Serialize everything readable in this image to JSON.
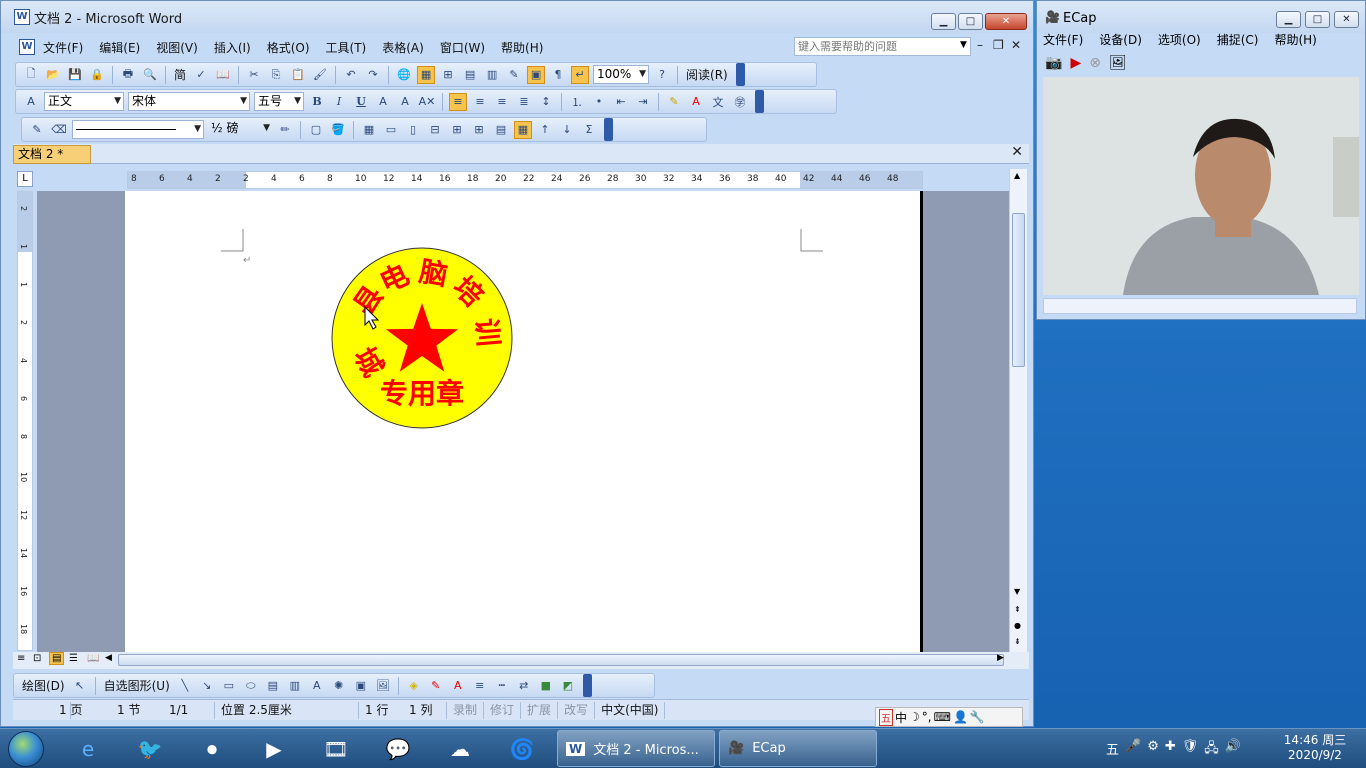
{
  "word": {
    "title": "文档 2 - Microsoft Word",
    "menus": [
      "文件(F)",
      "编辑(E)",
      "视图(V)",
      "插入(I)",
      "格式(O)",
      "工具(T)",
      "表格(A)",
      "窗口(W)",
      "帮助(H)"
    ],
    "help_placeholder": "键入需要帮助的问题",
    "toolbar1": {
      "zoom": "100%",
      "read_label": "阅读(R)",
      "simplified": "简"
    },
    "toolbar2": {
      "style": "正文",
      "font": "宋体",
      "size": "五号"
    },
    "toolbar3": {
      "line_weight": "½ 磅"
    },
    "doc_tab": "文档 2 *",
    "ruler_h": [
      "8",
      "6",
      "4",
      "2",
      "2",
      "4",
      "6",
      "8",
      "10",
      "12",
      "14",
      "16",
      "18",
      "20",
      "22",
      "24",
      "26",
      "28",
      "30",
      "32",
      "34",
      "36",
      "38",
      "40",
      "42",
      "44",
      "46",
      "48"
    ],
    "ruler_v": [
      "2",
      "1",
      "1",
      "2",
      "4",
      "6",
      "8",
      "10",
      "12",
      "14",
      "16",
      "18"
    ],
    "stamp": {
      "ring_chars": [
        "县",
        "电",
        "脑",
        "培",
        "训"
      ],
      "left_char": "城",
      "bottom_text": "专用章",
      "fill": "#ffff00",
      "text_color": "#ff0000"
    },
    "draw_toolbar": {
      "draw_label": "绘图(D)",
      "autoshape_label": "自选图形(U)"
    },
    "status": {
      "page": "1 页",
      "section": "1 节",
      "pages": "1/1",
      "position": "位置 2.5厘米",
      "line": "1 行",
      "col": "1 列",
      "rec": "录制",
      "trk": "修订",
      "ext": "扩展",
      "ovr": "改写",
      "lang": "中文(中国)"
    },
    "ime": {
      "mode_icon": "五",
      "lang": "中"
    }
  },
  "ecap": {
    "title": "ECap",
    "menus": [
      "文件(F)",
      "设备(D)",
      "选项(O)",
      "捕捉(C)",
      "帮助(H)"
    ]
  },
  "taskbar": {
    "word_task": "文档 2 - Micros...",
    "ecap_task": "ECap",
    "time": "14:46 周三",
    "date": "2020/9/2"
  }
}
